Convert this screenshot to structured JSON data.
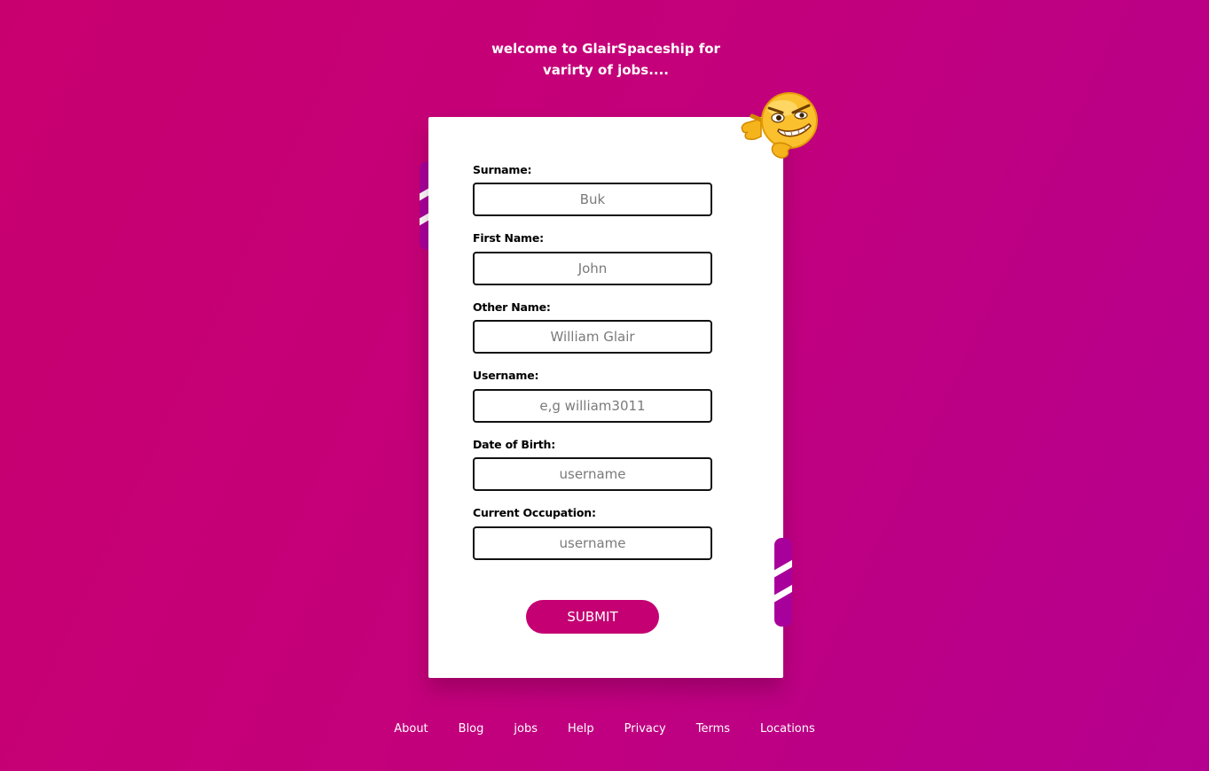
{
  "header": {
    "line1": "welcome to GlairSpaceship for",
    "line2": "varirty of jobs...."
  },
  "form": {
    "fields": [
      {
        "label": "Surname:",
        "placeholder": "Buk"
      },
      {
        "label": "First Name:",
        "placeholder": "John"
      },
      {
        "label": "Other Name:",
        "placeholder": "William Glair"
      },
      {
        "label": "Username:",
        "placeholder": "e,g william3011"
      },
      {
        "label": "Date of Birth:",
        "placeholder": "username"
      },
      {
        "label": "Current Occupation:",
        "placeholder": "username"
      }
    ],
    "submit_label": "SUBMIT"
  },
  "decoration": {
    "emoji_icon": "smirking-emoji-pointing-icon"
  },
  "footer": {
    "links": [
      "About",
      "Blog",
      "jobs",
      "Help",
      "Privacy",
      "Terms",
      "Locations"
    ]
  },
  "colors": {
    "background_start": "#c8006f",
    "background_end": "#b5008f",
    "accent": "#c40072",
    "tab": "#a8009a",
    "card": "#ffffff"
  }
}
